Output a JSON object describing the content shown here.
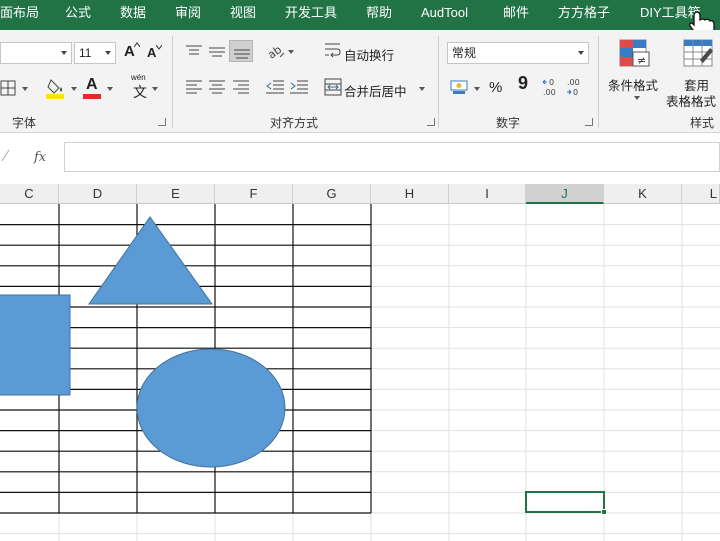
{
  "tabs": [
    "面布局",
    "公式",
    "数据",
    "审阅",
    "视图",
    "开发工具",
    "帮助",
    "AudTool",
    "邮件",
    "方方格子",
    "DIY工具箱"
  ],
  "ribbon": {
    "font_size": "11",
    "font_grow_label": "A",
    "font_shrink_label": "A",
    "wen_label": "wén",
    "wen_char": "文",
    "font_color_label": "A",
    "wrap_text_label": "自动换行",
    "merge_center_label": "合并后居中",
    "number_format": "常规",
    "percent_label": "%",
    "comma_label": "9",
    "decimal_increase_label": "←0\n.00",
    "decimal_decrease_label": ".00\n→0",
    "conditional_format_label": "条件格式",
    "table_format_line1": "套用",
    "table_format_line2": "表格格式",
    "groups": {
      "font": "字体",
      "alignment": "对齐方式",
      "number": "数字",
      "styles": "样式"
    },
    "accent_fill_color": "#ffe11a",
    "accent_font_color": "#e32b2b"
  },
  "formula_bar": {
    "fx_label": "fx",
    "value": ""
  },
  "sheet": {
    "columns": [
      "C",
      "D",
      "E",
      "F",
      "G",
      "H",
      "I",
      "J",
      "K",
      "L"
    ],
    "selected_column": "J",
    "shape_fill": "#5b9bd5",
    "shape_stroke": "#41719c",
    "shapes": [
      "triangle",
      "rectangle",
      "ellipse"
    ]
  }
}
